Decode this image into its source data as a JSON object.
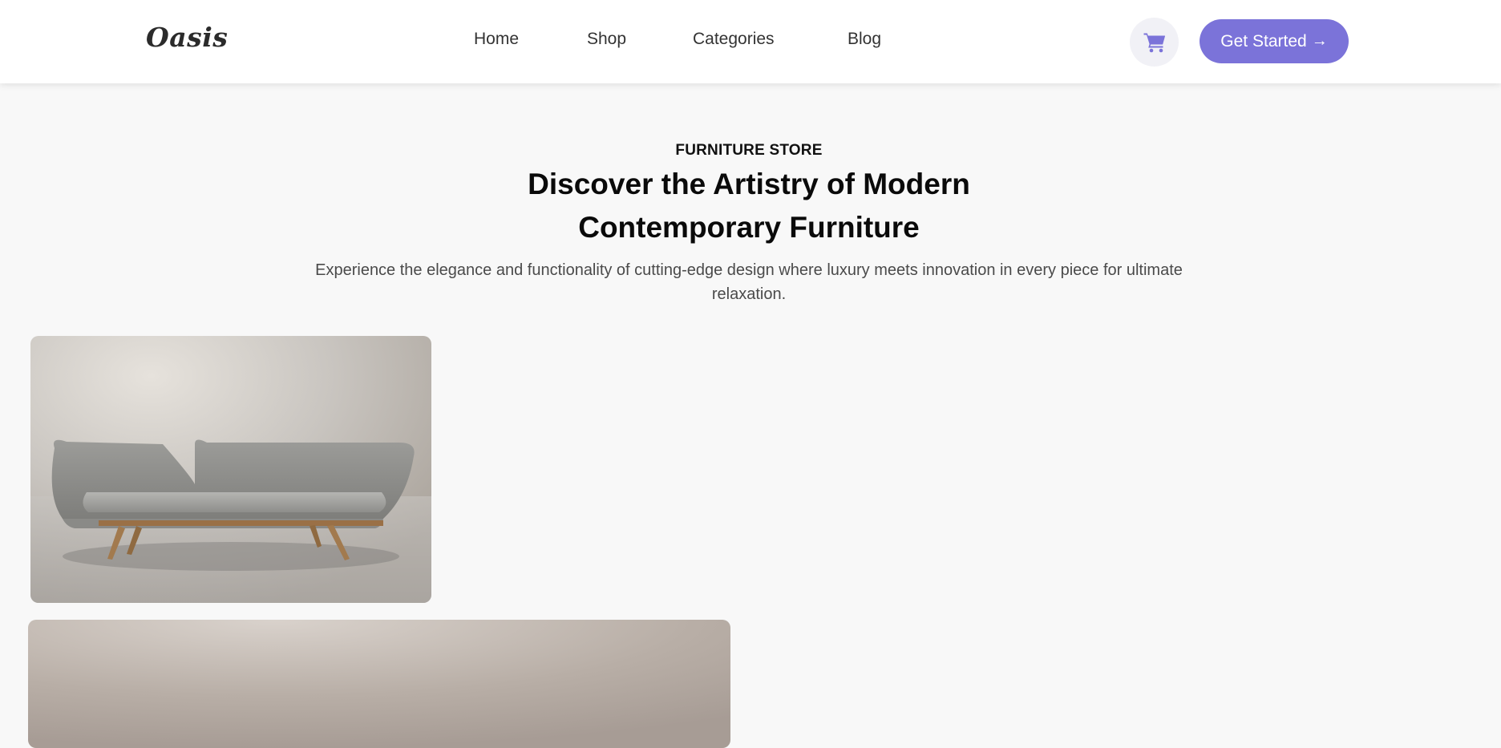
{
  "brand": {
    "name": "Oasis"
  },
  "nav": {
    "links": [
      {
        "label": "Home"
      },
      {
        "label": "Shop"
      },
      {
        "label": "Categories"
      },
      {
        "label": "Blog"
      }
    ],
    "cart_icon": "shopping-cart-icon",
    "cta_label": "Get Started",
    "cta_arrow": "→"
  },
  "hero": {
    "eyebrow": "FURNITURE STORE",
    "title_line1": "Discover the Artistry of Modern",
    "title_line2": "Contemporary Furniture",
    "description": "Experience the elegance and functionality of cutting-edge design where luxury meets innovation in every piece for ultimate relaxation."
  },
  "gallery": [
    {
      "subject": "grey sofa with wooden legs"
    },
    {
      "subject": "product photo (partially visible)"
    }
  ],
  "colors": {
    "accent": "#7b73d9",
    "background": "#f8f8f8",
    "nav_background": "#ffffff",
    "cart_bg": "#f1f1f6"
  }
}
